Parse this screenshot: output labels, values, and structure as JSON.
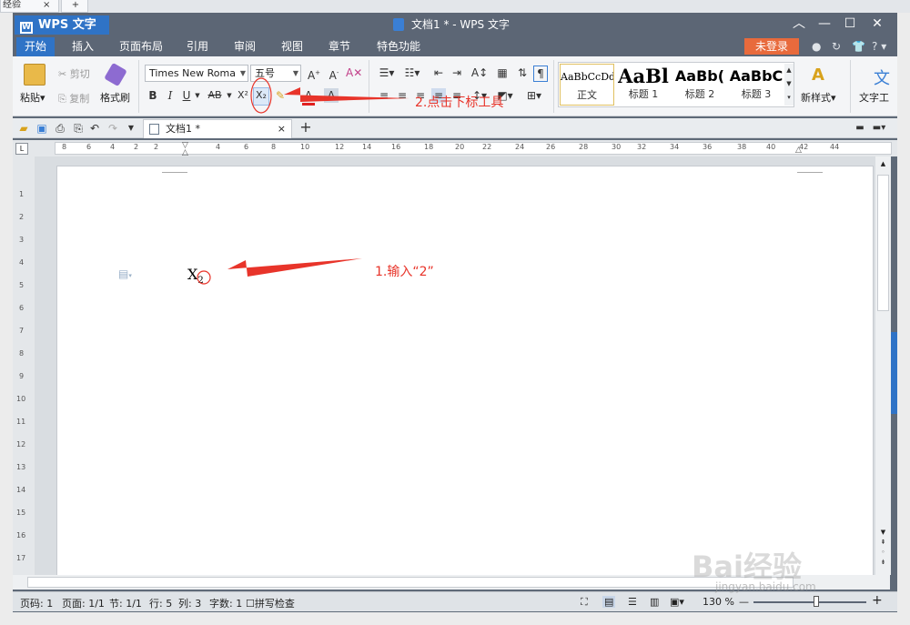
{
  "browser": {
    "tab_label": "经验",
    "close": "×",
    "new": "+"
  },
  "app": {
    "menu_label": "WPS 文字",
    "title": "文档1 * - WPS 文字"
  },
  "menus": [
    "开始",
    "插入",
    "页面布局",
    "引用",
    "审阅",
    "视图",
    "章节",
    "特色功能"
  ],
  "login_label": "未登录",
  "help_label": "?",
  "clipboard": {
    "paste": "粘贴",
    "cut": "剪切",
    "copy": "复制",
    "format_painter": "格式刷"
  },
  "font": {
    "name": "Times New Roma",
    "size": "五号"
  },
  "format_buttons": {
    "bold": "B",
    "italic": "I",
    "underline": "U",
    "strike": "AB",
    "superscript": "X²",
    "subscript": "X₂",
    "font_color": "A"
  },
  "styles": [
    {
      "sample": "AaBbCcDd",
      "name": "正文"
    },
    {
      "sample": "AaBl",
      "name": "标题 1"
    },
    {
      "sample": "AaBb(",
      "name": "标题 2"
    },
    {
      "sample": "AaBbC",
      "name": "标题 3"
    }
  ],
  "new_style_label": "新样式",
  "text_tools_label": "文字工",
  "doc_tab": "文档1 *",
  "ruler_numbers": [
    "8",
    "6",
    "4",
    "2",
    "2",
    "4",
    "6",
    "8",
    "10",
    "12",
    "14",
    "16",
    "18",
    "20",
    "22",
    "24",
    "26",
    "28",
    "30",
    "32",
    "34",
    "36",
    "38",
    "40",
    "42",
    "44"
  ],
  "vruler_numbers": [
    "1",
    "2",
    "3",
    "4",
    "5",
    "6",
    "7",
    "8",
    "9",
    "10",
    "11",
    "12",
    "13",
    "14",
    "15",
    "16",
    "17"
  ],
  "document": {
    "base": "X",
    "subscript": "2"
  },
  "annotations": {
    "step1": "1.输入“2”",
    "step2": "2.点击下标工具"
  },
  "status": {
    "page_num": "页码: 1",
    "pages": "页面: 1/1",
    "section": "节: 1/1",
    "row": "行: 5",
    "col": "列: 3",
    "words": "字数: 1",
    "spell": "拼写检查"
  },
  "zoom": {
    "label": "130 %",
    "level_fraction": 0.56
  },
  "watermark": {
    "text": "Bai经验",
    "url": "jingyan.baidu.com"
  },
  "colors": {
    "accent": "#2f73c6",
    "title_bar": "#5c6675",
    "annotation": "#e8342a",
    "login": "#e86a3c"
  }
}
